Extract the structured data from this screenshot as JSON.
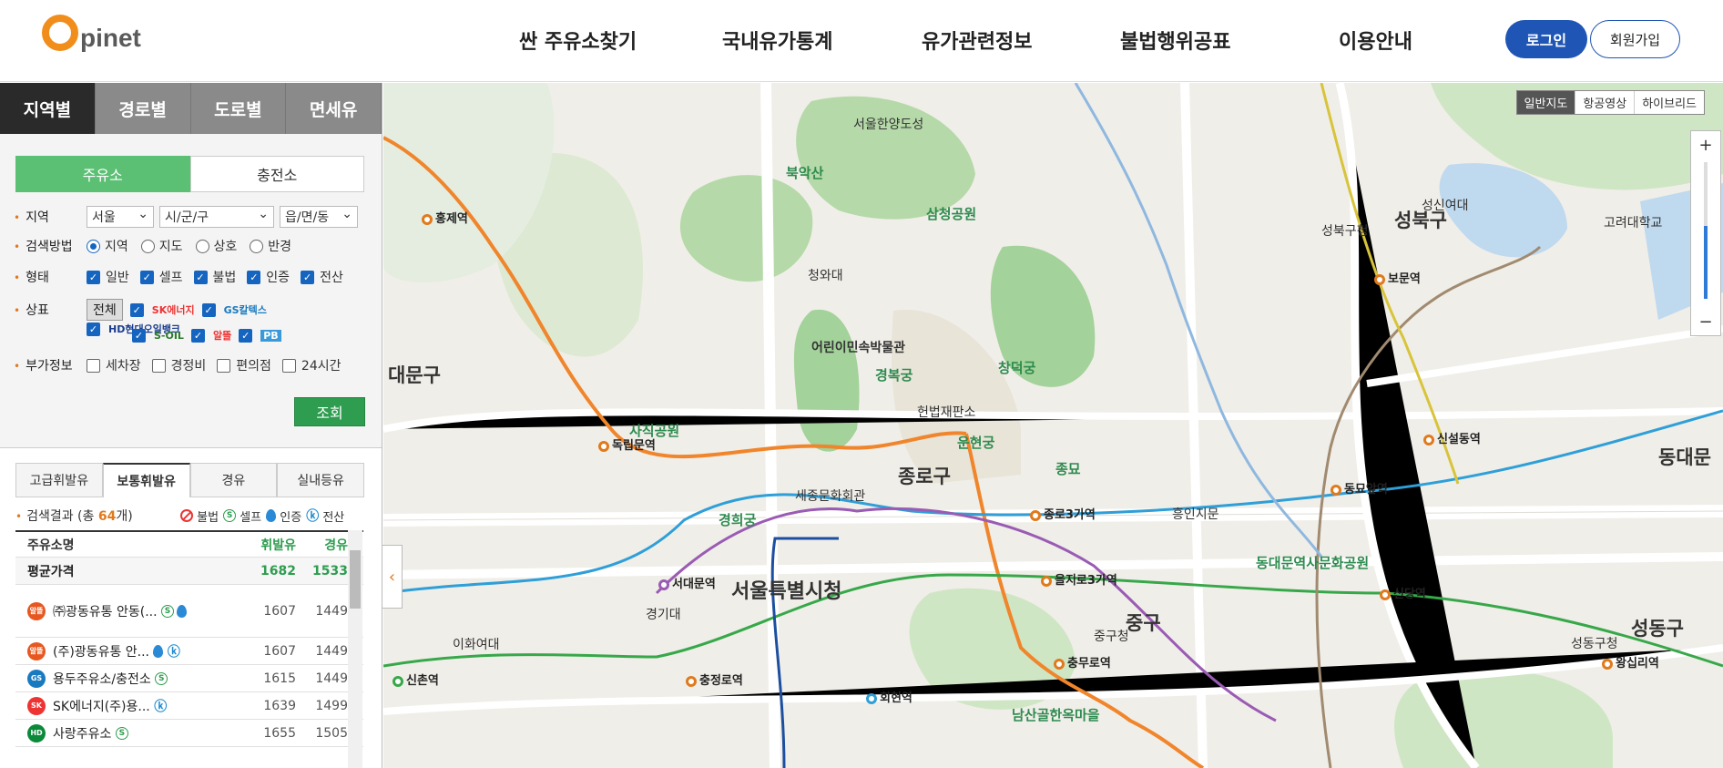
{
  "header": {
    "logo_text": "pinet",
    "menu": [
      "싼 주유소찾기",
      "국내유가통계",
      "유가관련정보",
      "불법행위공표",
      "이용안내"
    ],
    "login_label": "로그인",
    "join_label": "회원가입"
  },
  "left": {
    "tabs": [
      "지역별",
      "경로별",
      "도로별",
      "면세유"
    ],
    "subtabs": [
      "주유소",
      "충전소"
    ],
    "region_label": "지역",
    "region_values": [
      "서울",
      "시/군/구",
      "읍/면/동"
    ],
    "method_label": "검색방법",
    "methods": [
      "지역",
      "지도",
      "상호",
      "반경"
    ],
    "type_label": "형태",
    "types": [
      "일반",
      "셀프",
      "불법",
      "인증",
      "전산"
    ],
    "brand_label": "상표",
    "brand_all": "전체",
    "brands": [
      "SK에너지",
      "GS칼텍스",
      "HD현대오일뱅크",
      "S-OIL",
      "알뜰",
      "PB"
    ],
    "extra_label": "부가정보",
    "extras": [
      "세차장",
      "경정비",
      "편의점",
      "24시간"
    ],
    "search_label": "조회"
  },
  "result": {
    "fuel_tabs": [
      "고급휘발유",
      "보통휘발유",
      "경유",
      "실내등유"
    ],
    "count_prefix": "검색결과 (총 ",
    "count": "64",
    "count_suffix": "개)",
    "legend": [
      "불법",
      "셀프",
      "인증",
      "전산"
    ],
    "headers": [
      "주유소명",
      "휘발유",
      "경유"
    ],
    "avg_label": "평균가격",
    "avg_gas": "1682",
    "avg_diesel": "1533",
    "rows": [
      {
        "name": "㈜광동유통 안동(...",
        "gas": "1607",
        "diesel": "1449"
      },
      {
        "name": "(주)광동유통 안...",
        "gas": "1607",
        "diesel": "1449"
      },
      {
        "name": "용두주유소/충전소",
        "gas": "1615",
        "diesel": "1449"
      },
      {
        "name": "SK에너지(주)용...",
        "gas": "1639",
        "diesel": "1499"
      },
      {
        "name": "사랑주유소",
        "gas": "1655",
        "diesel": "1505"
      }
    ]
  },
  "map": {
    "types": [
      "일반지도",
      "항공영상",
      "하이브리드"
    ],
    "labels": {
      "city_hall": "서울특별시청",
      "jongno": "종로구",
      "junggu": "중구",
      "seongbuk": "성북구",
      "seongdong": "성동구",
      "dongdaemun": "동대문",
      "daemun": "대문구",
      "gyeongbok": "경복궁",
      "changdeok": "창덕궁",
      "bugak": "북악산",
      "samcheong": "삼청공원",
      "sajik": "사직공원",
      "namsan": "남산골한옥마을",
      "cheongwa": "청와대",
      "children_museum": "어린이민속박물관",
      "heonbeop": "헌법재판소",
      "unhyeon": "운현궁",
      "jongmyo": "종묘",
      "sejong": "세종문화회관",
      "gyeonghui": "경희궁",
      "seodaemun_st": "서대문역",
      "dongnimmun": "독립문역",
      "jongno3": "종로3가역",
      "euljiro3": "을지로3가역",
      "chungmuro": "충무로역",
      "sindang": "신당역",
      "dongmyo": "동묘앞역",
      "sinseol": "신설동역",
      "bomun": "보문역",
      "wangsimni": "왕십리역",
      "chungjeongno": "충정로역",
      "hoehyeon": "회현역",
      "hongje": "홍제역",
      "heunginjimun": "흥인지문",
      "ddp": "동대문역사문화공원",
      "seoul_city_wall": "서울한양도성",
      "korea_univ": "고려대학교",
      "seongshin": "성신여대",
      "seongbuk_office": "성북구청",
      "junggu_office": "중구청",
      "seongdong_office": "성동구청",
      "ewha": "이화여대",
      "gyeonggi": "경기대",
      "sinchon": "신촌역"
    }
  }
}
